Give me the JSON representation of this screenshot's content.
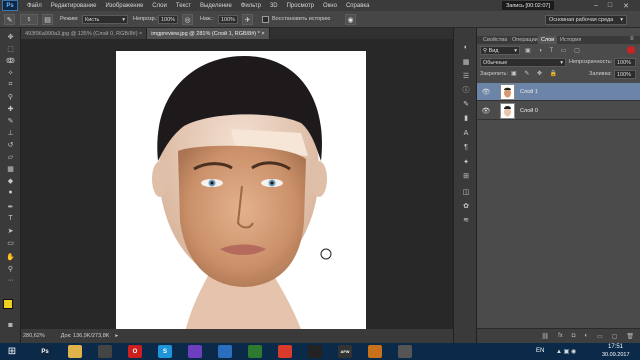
{
  "menu": {
    "items": [
      "Файл",
      "Редактирование",
      "Изображение",
      "Слои",
      "Текст",
      "Выделение",
      "Фильтр",
      "3D",
      "Просмотр",
      "Окно",
      "Справка"
    ],
    "logo": "Ps"
  },
  "recording": "Запись [00:02:07]",
  "options": {
    "brush_size": "5",
    "mode_label": "Режим:",
    "mode_value": "Кисть",
    "opacity_label": "Непрозр.:",
    "opacity_value": "100%",
    "flow_label": "Наж.:",
    "flow_value": "100%",
    "history_label": "Восстановить историю"
  },
  "workspace": "Основная рабочая среда",
  "tabs": [
    {
      "label": "493f96a990a3.jpg @ 135% (Слой 0, RGB/8#) ×",
      "active": false
    },
    {
      "label": "imgpreview.jpg @ 281% (Слой 1, RGB/8#) * ×",
      "active": true
    }
  ],
  "status": {
    "zoom": "280,62%",
    "doc": "Док: 136,9K/273,8K"
  },
  "panel": {
    "tabs": [
      "Свойства",
      "Операции",
      "Слои",
      "История"
    ],
    "active_tab": "Слои",
    "kind_label": "Вид",
    "blend_mode": "Обычные",
    "opacity_label": "Непрозрачность:",
    "opacity_value": "100%",
    "lock_label": "Закрепить:",
    "fill_label": "Заливка:",
    "fill_value": "100%",
    "layers": [
      {
        "name": "Слой 1",
        "selected": true
      },
      {
        "name": "Слой 0",
        "selected": false
      }
    ]
  },
  "taskbar": {
    "language": "EN",
    "time": "17:51",
    "date": "30.09.2017",
    "icons": [
      {
        "name": "photoshop-icon",
        "label": "Ps",
        "color": "#0f2742"
      },
      {
        "name": "file-explorer-icon",
        "label": "",
        "color": "#e0b24a"
      },
      {
        "name": "media-player-icon",
        "label": "",
        "color": "#444"
      },
      {
        "name": "opera-icon",
        "label": "O",
        "color": "#cc1f1f"
      },
      {
        "name": "skype-icon",
        "label": "S",
        "color": "#1e95d8"
      },
      {
        "name": "vs-icon",
        "label": "",
        "color": "#6d3ebd"
      },
      {
        "name": "arrow-app-icon",
        "label": "",
        "color": "#2a6fbd"
      },
      {
        "name": "browser-icon",
        "label": "",
        "color": "#2e7a2e"
      },
      {
        "name": "chrome-icon",
        "label": "",
        "color": "#d93a2b"
      },
      {
        "name": "dark-app-icon",
        "label": "",
        "color": "#222"
      },
      {
        "name": "afw-icon",
        "label": "AFW",
        "color": "#333"
      },
      {
        "name": "cs-icon",
        "label": "",
        "color": "#c8711a"
      },
      {
        "name": "tool-app-icon",
        "label": "",
        "color": "#555"
      }
    ]
  },
  "colors": {
    "foreground": "#f0d020",
    "background": "#ffffff",
    "accent": "#0a64c8"
  }
}
